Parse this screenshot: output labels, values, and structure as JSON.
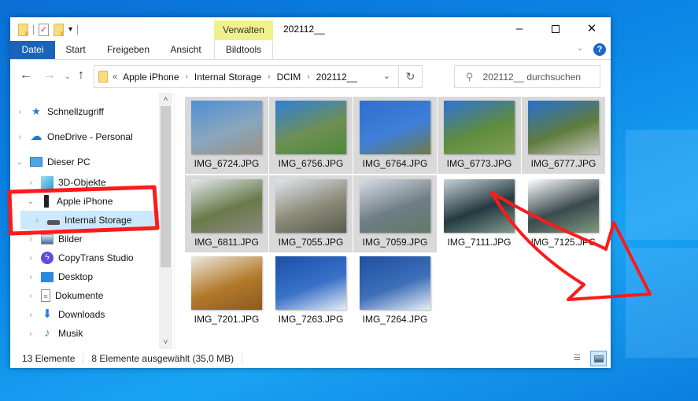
{
  "window": {
    "title": "202112__",
    "context_tab_header": "Verwalten",
    "controls": {
      "minimize": "–",
      "maximize": "",
      "close": "✕"
    }
  },
  "quick_access": {
    "icons": [
      "folder-icon",
      "properties-icon",
      "new-folder-icon",
      "customize-dropdown-icon"
    ]
  },
  "ribbon": {
    "tabs": [
      {
        "label": "Datei",
        "active": true
      },
      {
        "label": "Start"
      },
      {
        "label": "Freigeben"
      },
      {
        "label": "Ansicht"
      },
      {
        "label": "Bildtools"
      }
    ],
    "expand_icon": "⌄",
    "help_icon": "?"
  },
  "navigation": {
    "back": "←",
    "forward": "→",
    "recent": "⌄",
    "up": "↑",
    "address_prefix": "«",
    "breadcrumbs": [
      "Apple iPhone",
      "Internal Storage",
      "DCIM",
      "202112__"
    ],
    "separator": "›",
    "dropdown": "⌄",
    "refresh": "↻",
    "search_placeholder": "202112__ durchsuchen",
    "search_icon": "⚲"
  },
  "sidebar": {
    "items": [
      {
        "label": "Schnellzugriff",
        "icon": "★",
        "chevron": "›"
      },
      {
        "label": "OneDrive - Personal",
        "icon": "☁",
        "chevron": "›"
      },
      {
        "label": "Dieser PC",
        "icon": "",
        "chevron": "⌄"
      },
      {
        "label": "3D-Objekte",
        "icon": "",
        "chevron": "›"
      },
      {
        "label": "Apple iPhone",
        "icon": "",
        "chevron": "⌄"
      },
      {
        "label": "Internal Storage",
        "icon": "",
        "chevron": "›",
        "selected": true
      },
      {
        "label": "Bilder",
        "icon": "",
        "chevron": "›"
      },
      {
        "label": "CopyTrans Studio",
        "icon": "ϟ",
        "chevron": "›"
      },
      {
        "label": "Desktop",
        "icon": "",
        "chevron": "›"
      },
      {
        "label": "Dokumente",
        "icon": "≡",
        "chevron": "›"
      },
      {
        "label": "Downloads",
        "icon": "⬇",
        "chevron": "›"
      },
      {
        "label": "Musik",
        "icon": "♪",
        "chevron": "›"
      }
    ],
    "scroll_up": "˄",
    "scroll_down": "˅"
  },
  "files": [
    {
      "name": "IMG_6724.JPG",
      "selected": true,
      "colors": [
        "#4d8fd6",
        "#8aa6bd",
        "#9a9186"
      ]
    },
    {
      "name": "IMG_6756.JPG",
      "selected": true,
      "colors": [
        "#2e7fde",
        "#6f8f54",
        "#4c8a3a"
      ]
    },
    {
      "name": "IMG_6764.JPG",
      "selected": true,
      "colors": [
        "#2f6fcf",
        "#3f7fd8",
        "#6f7a4a"
      ]
    },
    {
      "name": "IMG_6773.JPG",
      "selected": true,
      "colors": [
        "#2f72d6",
        "#5f8c3f",
        "#7fa050"
      ]
    },
    {
      "name": "IMG_6777.JPG",
      "selected": true,
      "colors": [
        "#2a6fd2",
        "#5e7c3e",
        "#c9c6c0"
      ]
    },
    {
      "name": "IMG_6811.JPG",
      "selected": true,
      "colors": [
        "#e3e8ee",
        "#6a7a4a",
        "#8a8880"
      ]
    },
    {
      "name": "IMG_7055.JPG",
      "selected": true,
      "colors": [
        "#dfe5ee",
        "#8a8a78",
        "#5a5a4e"
      ]
    },
    {
      "name": "IMG_7059.JPG",
      "selected": true,
      "colors": [
        "#d8dde6",
        "#6f7e86",
        "#5f7a68"
      ]
    },
    {
      "name": "IMG_7111.JPG",
      "selected": false,
      "colors": [
        "#c8d2d8",
        "#243a40",
        "#7f9a90"
      ]
    },
    {
      "name": "IMG_7125.JPG",
      "selected": false,
      "colors": [
        "#ffffff",
        "#3a4a4e",
        "#7f9a7e"
      ]
    },
    {
      "name": "IMG_7201.JPG",
      "selected": false,
      "colors": [
        "#ece8e0",
        "#b27a2a",
        "#8a5a20"
      ]
    },
    {
      "name": "IMG_7263.JPG",
      "selected": false,
      "colors": [
        "#1a4fa8",
        "#3a72c8",
        "#e6ecf3"
      ]
    },
    {
      "name": "IMG_7264.JPG",
      "selected": false,
      "colors": [
        "#1f4fa2",
        "#3e6fb8",
        "#e8eef6"
      ]
    }
  ],
  "status": {
    "count": "13 Elemente",
    "selection": "8 Elemente ausgewählt (35,0 MB)"
  },
  "colors": {
    "accent": "#1c62b9",
    "context_tab": "#eff18a",
    "selection_tree": "#cce8ff",
    "selection_tile": "#d9d9d9",
    "annotation": "#ff1a1a"
  }
}
